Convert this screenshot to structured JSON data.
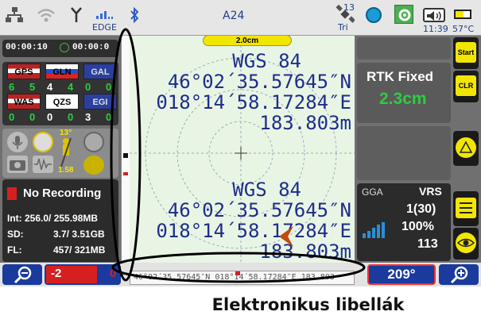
{
  "status_bar": {
    "network_type": "EDGE",
    "device": "A24",
    "satellite_count": "13",
    "correction_source": "Tri",
    "time": "11:39",
    "temperature": "57°C"
  },
  "timers": {
    "elapsed": "00:00:10",
    "remaining": "00:00:0"
  },
  "constellations": [
    {
      "label": "GPS",
      "count_a": "6",
      "count_b": "5"
    },
    {
      "label": "GLN",
      "count_a": "4",
      "count_b": "4"
    },
    {
      "label": "GAL",
      "count_a": "0",
      "count_b": "0"
    },
    {
      "label": "WAS",
      "count_a": "0",
      "count_b": "0"
    },
    {
      "label": "QZS",
      "count_a": "0",
      "count_b": "0"
    },
    {
      "label": "EGI",
      "count_a": "3",
      "count_b": "0"
    }
  ],
  "tools": {
    "tilt_angle": "13°",
    "pole_height": "1.58"
  },
  "recording": {
    "status": "No Recording",
    "int_label": "Int:",
    "int_value": "256.0/ 255.98MB",
    "sd_label": "SD:",
    "sd_value": "3.7/ 3.51GB",
    "fl_label": "FL:",
    "fl_value": "457/ 321MB"
  },
  "scale": {
    "label": "2.0cm"
  },
  "position_top": {
    "datum": "WGS 84",
    "latitude": "46°02´35.57645″N",
    "longitude": "018°14´58.17284″E",
    "height": "183.803m"
  },
  "position_bottom": {
    "datum": "WGS 84",
    "latitude": "46°02´35.57645″N",
    "longitude": "018°14´58.17284″E",
    "height": "183.803m"
  },
  "level_strip": {
    "text": "46°02´35.57645″N 018°14´58.17284″E 183.803"
  },
  "fix": {
    "status": "RTK Fixed",
    "precision": "2.3cm"
  },
  "corrections": {
    "message": "GGA",
    "mode": "VRS",
    "age": "1(30)",
    "quality": "100%",
    "station": "113"
  },
  "buttons": {
    "start": "Start",
    "clear": "CLR"
  },
  "bottom": {
    "tilt_value": "-2",
    "tilt_right": "0",
    "heading": "209°"
  },
  "caption": "Elektronikus libellák",
  "colors": {
    "map_background": "#e8f5e4",
    "coord_text": "#1e2d8a",
    "fix_green": "#2ecc40",
    "accent_yellow": "#f2e600",
    "tilt_red": "#d62020",
    "heading_blue": "#1a3a9e"
  }
}
